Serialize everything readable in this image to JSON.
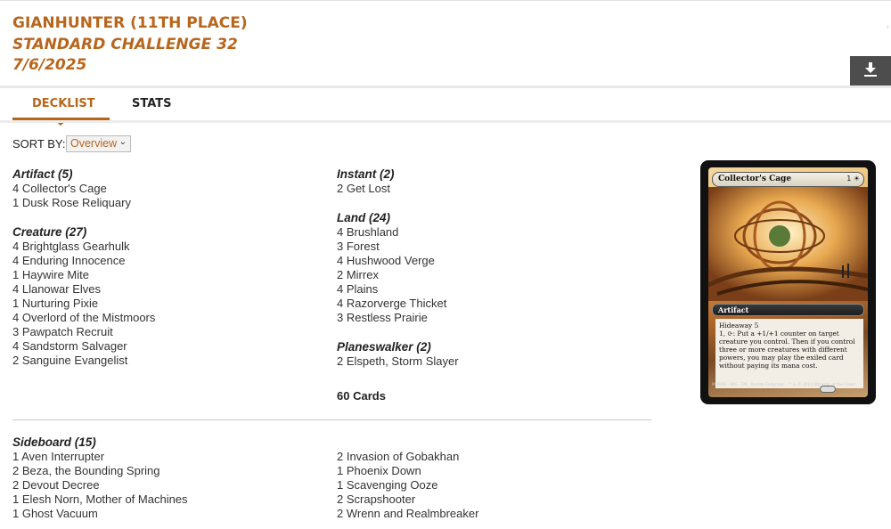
{
  "header": {
    "title": "GIANHUNTER (11TH PLACE)",
    "event": "STANDARD CHALLENGE 32",
    "date": "7/6/2025"
  },
  "tabs": [
    {
      "label": "DECKLIST",
      "active": true
    },
    {
      "label": "STATS",
      "active": false
    }
  ],
  "sort": {
    "label": "SORT BY:",
    "selected": "Overview"
  },
  "maindeck": {
    "artifact": {
      "heading": "Artifact (5)",
      "cards": [
        "4 Collector's Cage",
        "1 Dusk Rose Reliquary"
      ]
    },
    "creature": {
      "heading": "Creature (27)",
      "cards": [
        "4 Brightglass Gearhulk",
        "4 Enduring Innocence",
        "1 Haywire Mite",
        "4 Llanowar Elves",
        "1 Nurturing Pixie",
        "4 Overlord of the Mistmoors",
        "3 Pawpatch Recruit",
        "4 Sandstorm Salvager",
        "2 Sanguine Evangelist"
      ]
    },
    "instant": {
      "heading": "Instant (2)",
      "cards": [
        "2 Get Lost"
      ]
    },
    "land": {
      "heading": "Land (24)",
      "cards": [
        "4 Brushland",
        "3 Forest",
        "4 Hushwood Verge",
        "2 Mirrex",
        "4 Plains",
        "4 Razorverge Thicket",
        "3 Restless Prairie"
      ]
    },
    "planeswalker": {
      "heading": "Planeswalker (2)",
      "cards": [
        "2 Elspeth, Storm Slayer"
      ]
    },
    "total": "60 Cards"
  },
  "sideboard": {
    "heading": "Sideboard (15)",
    "left": [
      "1 Aven Interrupter",
      "2 Beza, the Bounding Spring",
      "2 Devout Decree",
      "1 Elesh Norn, Mother of Machines",
      "1 Ghost Vacuum"
    ],
    "right": [
      "2 Invasion of Gobakhan",
      "1 Phoenix Down",
      "1 Scavenging Ooze",
      "2 Scrapshooter",
      "2 Wrenn and Realmbreaker"
    ]
  },
  "card_preview": {
    "name": "Collector's Cage",
    "mana_cost": "1 ☀",
    "type_line": "Artifact",
    "rules_text": [
      "Hideaway 5",
      "1, ⟳: Put a +1/+1 counter on target creature you control. Then if you control three or more creatures with different powers, you may play the exiled card without paying its mana cost."
    ],
    "footer": "M 0066 · BIG · EN · Bartek Fedyczak · ™ & © 2024 Wizards of the Coast"
  },
  "icons": {
    "download": "download-icon",
    "select": "chevron-down-icon"
  },
  "colors": {
    "accent": "#b8661c",
    "button": "#4d4d4d"
  }
}
